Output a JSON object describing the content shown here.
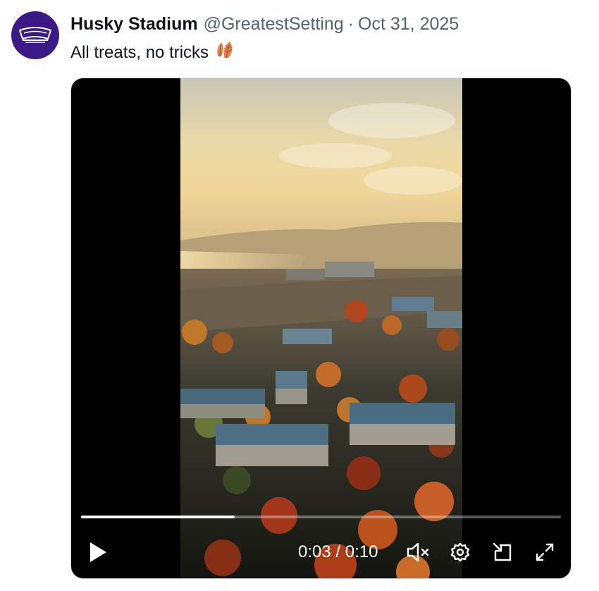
{
  "tweet": {
    "display_name": "Husky Stadium",
    "handle": "@GreatestSetting",
    "separator": "·",
    "date": "Oct 31, 2025",
    "text": "All treats, no tricks",
    "emoji": "fallen-leaf-emoji"
  },
  "avatar": {
    "icon": "stadium-logo-icon",
    "bg_color": "#3b1a86"
  },
  "video": {
    "current_time": "0:03",
    "duration": "0:10",
    "time_display": "0:03 / 0:10",
    "progress": 0.32,
    "muted": true,
    "controls": {
      "play_icon": "play-icon",
      "mute_icon": "speaker-muted-icon",
      "settings_icon": "gear-icon",
      "pip_icon": "picture-in-picture-icon",
      "fullscreen_icon": "fullscreen-expand-icon"
    }
  },
  "colors": {
    "name": "#0f1419",
    "secondary": "#536471",
    "media_border": "#cfd9de"
  }
}
